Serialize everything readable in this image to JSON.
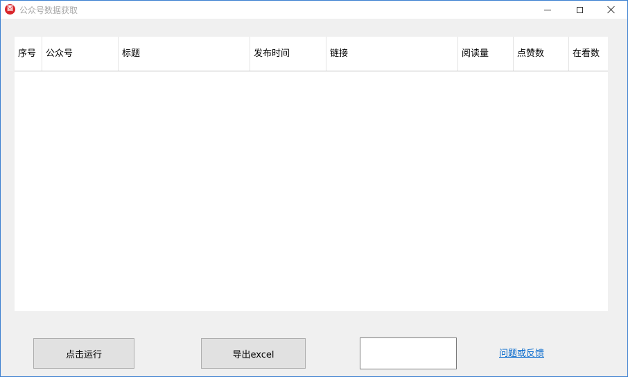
{
  "window": {
    "title": "公众号数据获取",
    "icon_glyph": "酉"
  },
  "table": {
    "columns": [
      "序号",
      "公众号",
      "标题",
      "发布时间",
      "链接",
      "阅读量",
      "点赞数",
      "在看数"
    ],
    "rows": []
  },
  "actions": {
    "run_label": "点击运行",
    "export_label": "导出excel",
    "input_value": "",
    "feedback_link": "问题或反馈"
  },
  "colors": {
    "window_bg": "#f0f0f0",
    "border": "#3a7fd0",
    "link": "#0066cc",
    "app_icon": "#d9262b"
  }
}
